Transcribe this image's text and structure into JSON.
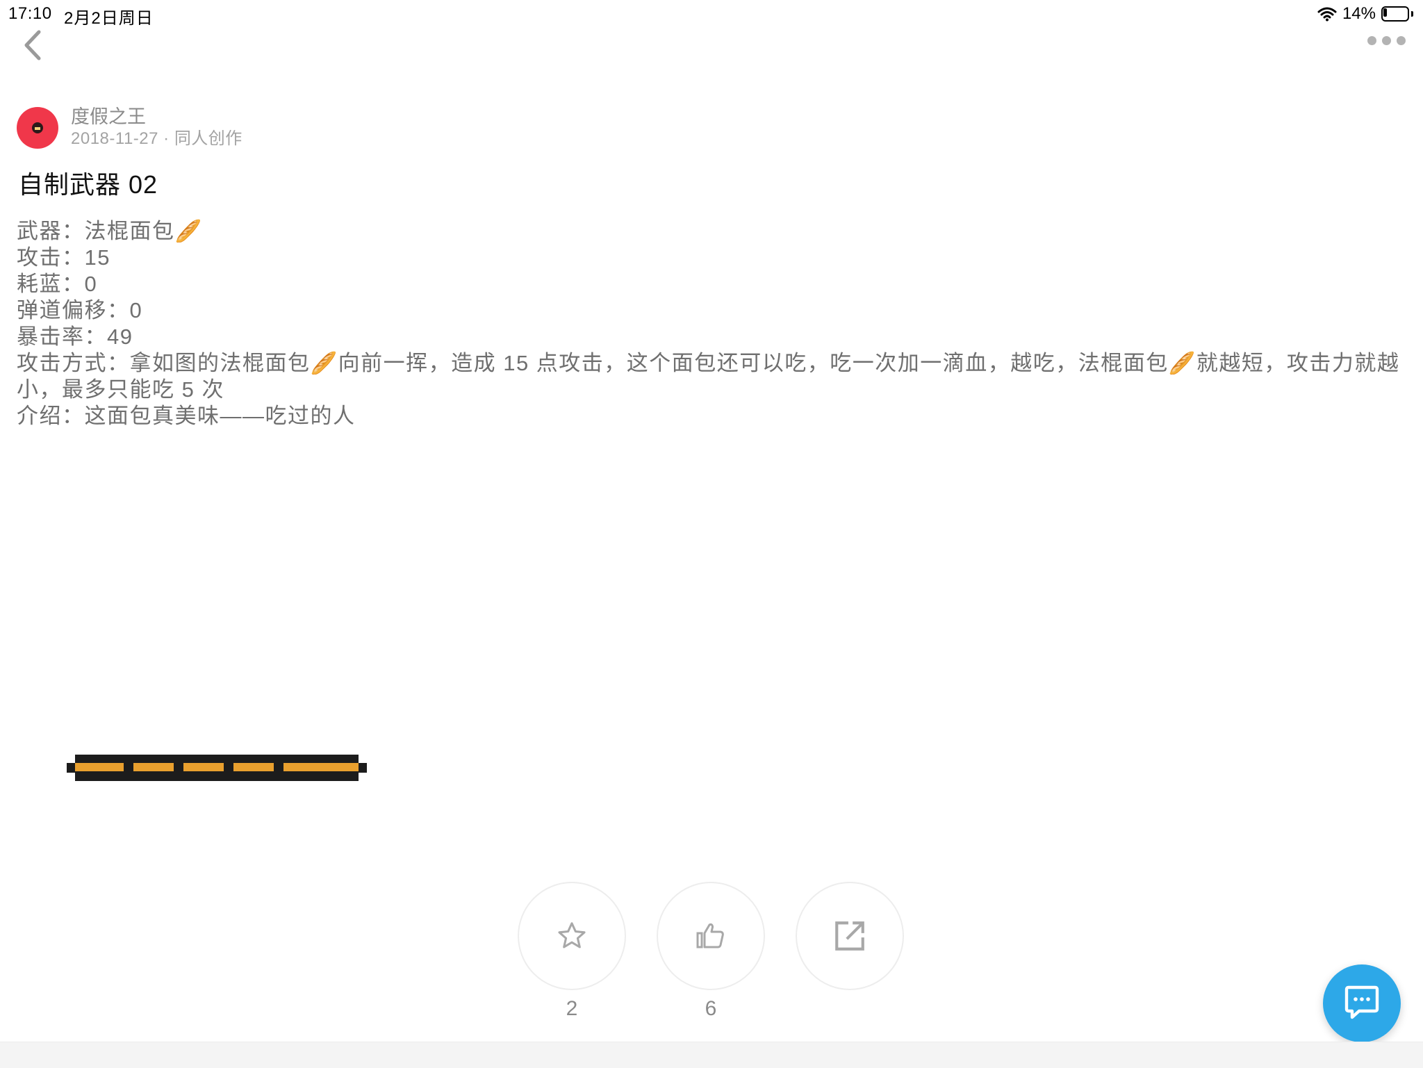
{
  "status_bar": {
    "time": "17:10",
    "date": "2月2日周日",
    "battery": "14%"
  },
  "nav": {
    "back_icon": "chevron-left-icon",
    "more_icon": "more-dots-icon"
  },
  "author": {
    "name": "度假之王",
    "meta": "2018-11-27 · 同人创作",
    "avatar_color": "#f0374a"
  },
  "post": {
    "title": "自制武器 02",
    "lines": [
      "武器：法棍面包🥖",
      "攻击：15",
      "耗蓝：0",
      "弹道偏移：0",
      "暴击率：49",
      "攻击方式：拿如图的法棍面包🥖向前一挥，造成 15 点攻击，这个面包还可以吃，吃一次加一滴血，越吃，法棍面包🥖就越短，攻击力就越小，最多只能吃 5 次",
      "介绍：这面包真美味——吃过的人"
    ]
  },
  "actions": {
    "favorite": {
      "icon": "star-icon",
      "count": "2"
    },
    "like": {
      "icon": "thumbs-up-icon",
      "count": "6"
    },
    "share": {
      "icon": "share-icon",
      "count": ""
    }
  },
  "colors": {
    "accent": "#2da8e8",
    "weapon_orange": "#e9a02e",
    "weapon_dark": "#1c1c1c"
  }
}
